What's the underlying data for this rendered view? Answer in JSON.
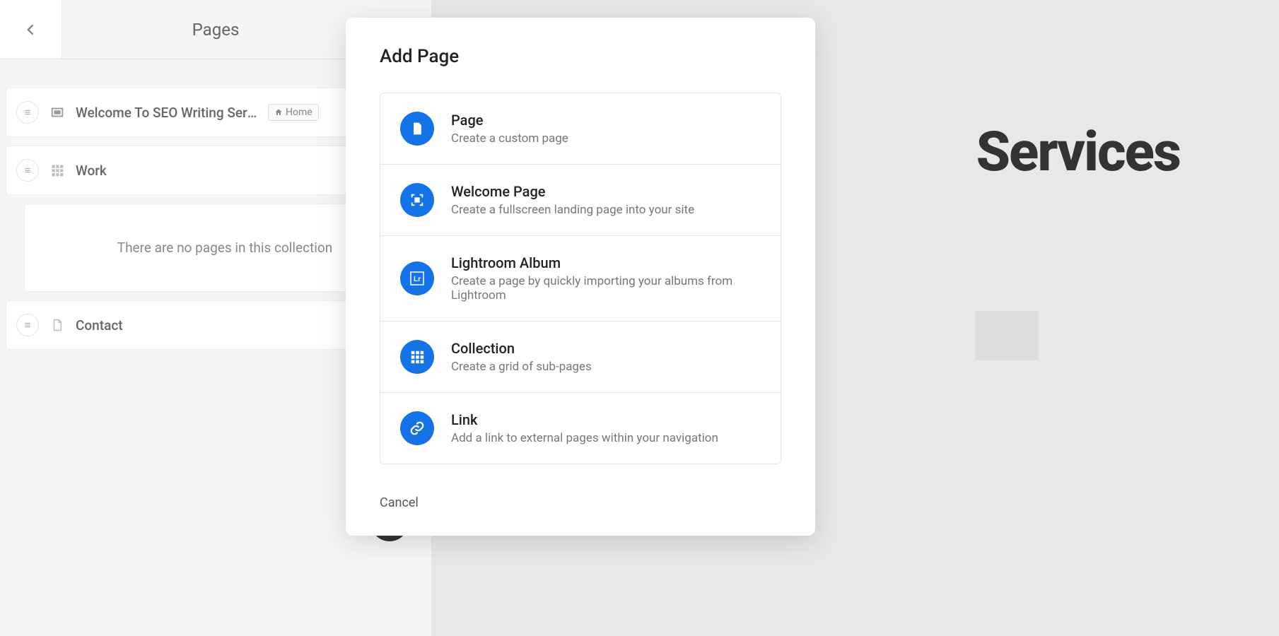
{
  "sidebar": {
    "title": "Pages",
    "items": [
      {
        "label": "Welcome To SEO Writing Servi...",
        "home_badge": "Home",
        "has_home": true,
        "icon": "welcome"
      },
      {
        "label": "Work",
        "has_home": false,
        "icon": "grid",
        "empty_text": "There are no pages in this collection"
      },
      {
        "label": "Contact",
        "has_home": false,
        "icon": "document"
      }
    ]
  },
  "preview": {
    "heading_fragment": "Services"
  },
  "modal": {
    "title": "Add Page",
    "options": [
      {
        "title": "Page",
        "desc": "Create a custom page"
      },
      {
        "title": "Welcome Page",
        "desc": "Create a fullscreen landing page into your site"
      },
      {
        "title": "Lightroom Album",
        "desc": "Create a page by quickly importing your albums from Lightroom"
      },
      {
        "title": "Collection",
        "desc": "Create a grid of sub-pages"
      },
      {
        "title": "Link",
        "desc": "Add a link to external pages within your navigation"
      }
    ],
    "cancel": "Cancel"
  }
}
